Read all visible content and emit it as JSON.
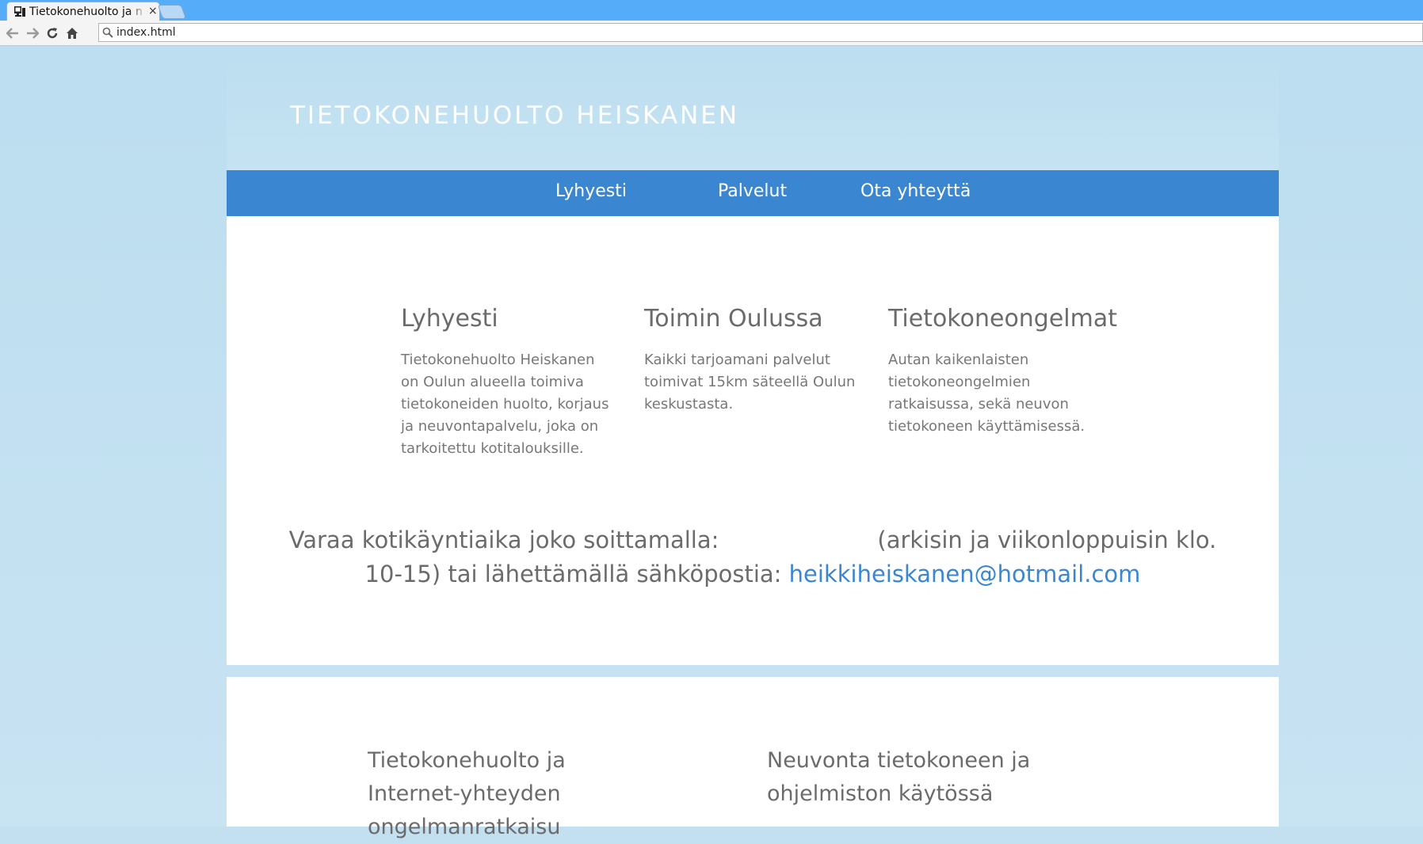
{
  "browser": {
    "tab_title": "Tietokonehuolto ja n",
    "tab_close": "×",
    "address": "index.html"
  },
  "site": {
    "title": "TIETOKONEHUOLTO HEISKANEN",
    "nav": [
      "Lyhyesti",
      "Palvelut",
      "Ota yhteyttä"
    ],
    "columns": [
      {
        "heading": "Lyhyesti",
        "text": "Tietokonehuolto Heiskanen on Oulun alueella toimiva tietokoneiden huolto, korjaus ja neuvontapalvelu, joka on tarkoitettu kotitalouksille."
      },
      {
        "heading": "Toimin Oulussa",
        "text": "Kaikki tarjoamani palvelut toimivat 15km säteellä Oulun keskustasta."
      },
      {
        "heading": "Tietokoneongelmat",
        "text": "Autan kaikenlaisten tietokoneongelmien ratkaisussa, sekä neuvon tietokoneen käyttämisessä."
      }
    ],
    "booking": {
      "lead": "Varaa kotikäyntiaika joko soittamalla:",
      "middle": "(arkisin ja viikonloppuisin klo. 10-15) tai lähettämällä sähköpostia:",
      "email": "heikkiheiskanen@hotmail.com"
    },
    "services": [
      "Tietokonehuolto ja Internet-yhteyden ongelmanratkaisu",
      "Neuvonta tietokoneen ja ohjelmiston käytössä"
    ]
  }
}
